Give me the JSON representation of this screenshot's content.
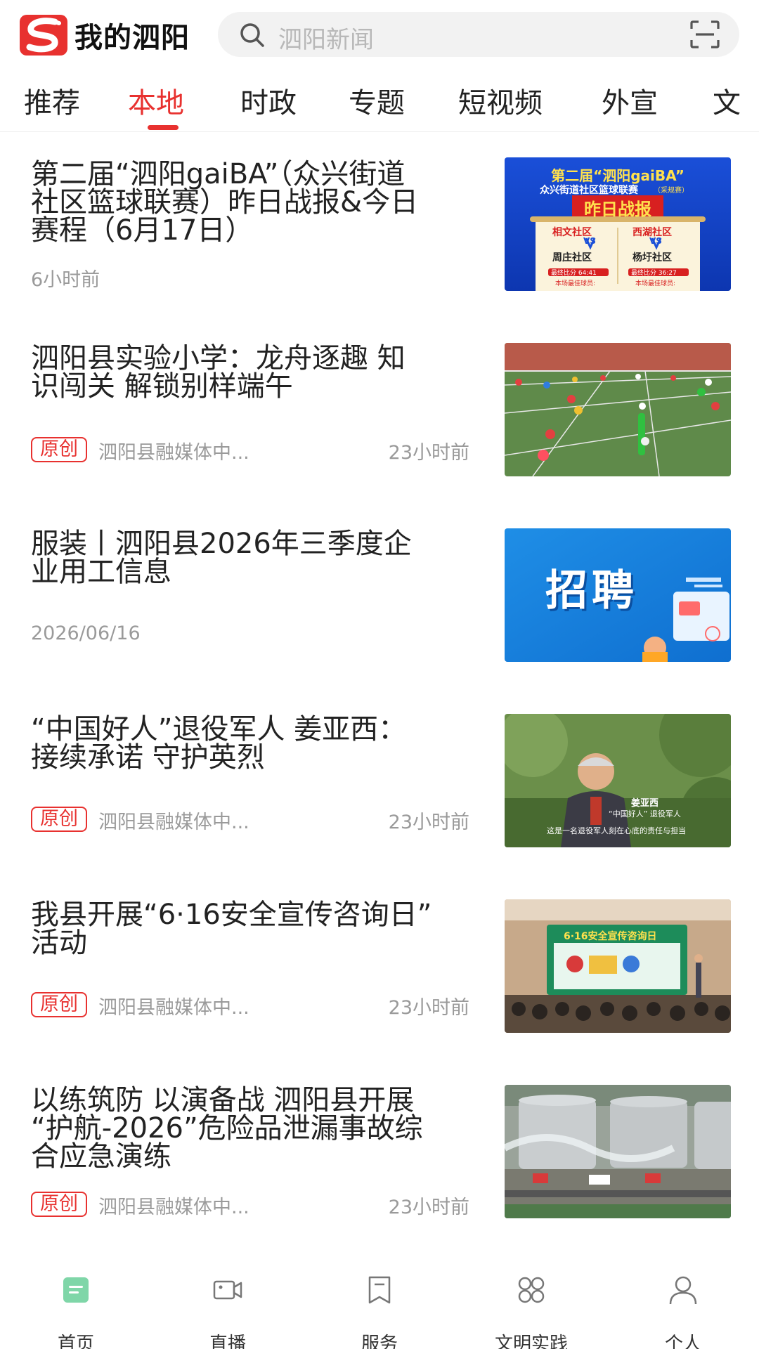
{
  "app": {
    "name": "我的泗阳",
    "brand_color": "#e8312f"
  },
  "search": {
    "placeholder": "泗阳新闻"
  },
  "tabs": [
    {
      "label": "推荐",
      "active": false
    },
    {
      "label": "本地",
      "active": true
    },
    {
      "label": "时政",
      "active": false
    },
    {
      "label": "专题",
      "active": false
    },
    {
      "label": "短视频",
      "active": false
    },
    {
      "label": "外宣",
      "active": false
    },
    {
      "label": "文",
      "active": false
    }
  ],
  "news": [
    {
      "title_lines": [
        "第二届“泗阳gaiBA”（众兴街道",
        "社区篮球联赛）昨日战报&今日",
        "赛程（6月17日）"
      ],
      "badge": "",
      "source": "",
      "time": "6小时前",
      "thumb": {
        "kind": "basketball-poster",
        "headline": "第二届“泗阳gaiBA”",
        "subline": "众兴街道社区篮球联赛",
        "stamp": "（采规赛）",
        "banner": "昨日战报",
        "left_top": "相文社区",
        "left_bottom": "周庄社区",
        "right_top": "西湖社区",
        "right_bottom": "杨圩社区",
        "vs": "VS",
        "left_score": "最终比分 64:41",
        "right_score": "最终比分 36:27",
        "mvp": "本场最佳球员:"
      }
    },
    {
      "title_lines": [
        "泗阳县实验小学：龙舟逐趣 知",
        "识闯关 解锁别样端午"
      ],
      "badge": "原创",
      "source": "泗阳县融媒体中...",
      "time": "23小时前",
      "thumb": {
        "kind": "sports-field"
      }
    },
    {
      "title_lines": [
        "服装丨泗阳县2026年三季度企",
        "业用工信息"
      ],
      "badge": "",
      "source": "",
      "time": "2026/06/16",
      "thumb": {
        "kind": "recruit-banner",
        "headline": "招聘"
      }
    },
    {
      "title_lines": [
        "“中国好人”退役军人 姜亚西：",
        "接续承诺 守护英烈"
      ],
      "badge": "原创",
      "source": "泗阳县融媒体中...",
      "time": "23小时前",
      "thumb": {
        "kind": "portrait",
        "name": "姜亚西",
        "subtitle": "“中国好人” 退役军人",
        "caption": "这是一名退役军人刻在心底的责任与担当"
      }
    },
    {
      "title_lines": [
        "我县开展“6·16安全宣传咨询日”",
        "活动"
      ],
      "badge": "原创",
      "source": "泗阳县融媒体中...",
      "time": "23小时前",
      "thumb": {
        "kind": "event-stage",
        "screen_title": "6·16安全宣传咨询日"
      }
    },
    {
      "title_lines": [
        "以练筑防 以演备战 泗阳县开展",
        "“护航-2026”危险品泄漏事故综",
        "合应急演练"
      ],
      "badge": "原创",
      "source": "泗阳县融媒体中...",
      "time": "23小时前",
      "thumb": {
        "kind": "tanks-drill"
      }
    }
  ],
  "bottom_nav": [
    {
      "label": "首页",
      "icon": "home-icon",
      "active": true
    },
    {
      "label": "直播",
      "icon": "video-camera-icon",
      "active": false
    },
    {
      "label": "服务",
      "icon": "bookmark-icon",
      "active": false
    },
    {
      "label": "文明实践",
      "icon": "grid-icon",
      "active": false
    },
    {
      "label": "个人",
      "icon": "user-icon",
      "active": false
    }
  ]
}
